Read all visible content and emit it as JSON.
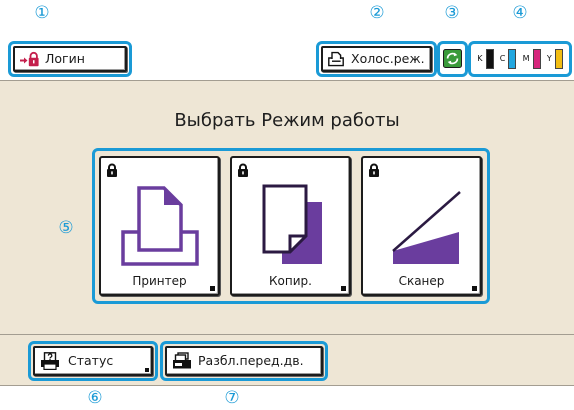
{
  "callouts": [
    "①",
    "②",
    "③",
    "④",
    "⑤",
    "⑥",
    "⑦"
  ],
  "colors": {
    "highlight": "#1a9ad6",
    "panel": "#eee6d5",
    "mode_icon": "#6a3d9e",
    "mode_icon_dark": "#2b1a42",
    "login_icon": "#c41f4c",
    "sync_icon": "#3a9a3a"
  },
  "header": {
    "login": {
      "label": "Логин",
      "icon": "login-lock-arrow-icon"
    },
    "idle": {
      "label": "Холос.реж.",
      "icon": "printer-outline-icon"
    },
    "sync_status": {
      "icon": "cycle-arrows-icon"
    },
    "ink": [
      {
        "letter": "K",
        "color": "#111111",
        "level": 1
      },
      {
        "letter": "C",
        "color": "#22a7e0",
        "level": 1
      },
      {
        "letter": "M",
        "color": "#d6267c",
        "level": 1
      },
      {
        "letter": "Y",
        "color": "#f2bd12",
        "level": 1
      }
    ]
  },
  "main": {
    "title": "Выбрать Режим работы",
    "modes": [
      {
        "label": "Принтер",
        "icon": "printer-icon",
        "locked": true
      },
      {
        "label": "Копир.",
        "icon": "copy-icon",
        "locked": true
      },
      {
        "label": "Сканер",
        "icon": "scanner-icon",
        "locked": true
      }
    ]
  },
  "footer": {
    "status": {
      "label": "Статус",
      "icon": "printer-question-icon"
    },
    "release": {
      "label": "Разбл.перед.дв.",
      "icon": "printer-door-icon"
    }
  }
}
